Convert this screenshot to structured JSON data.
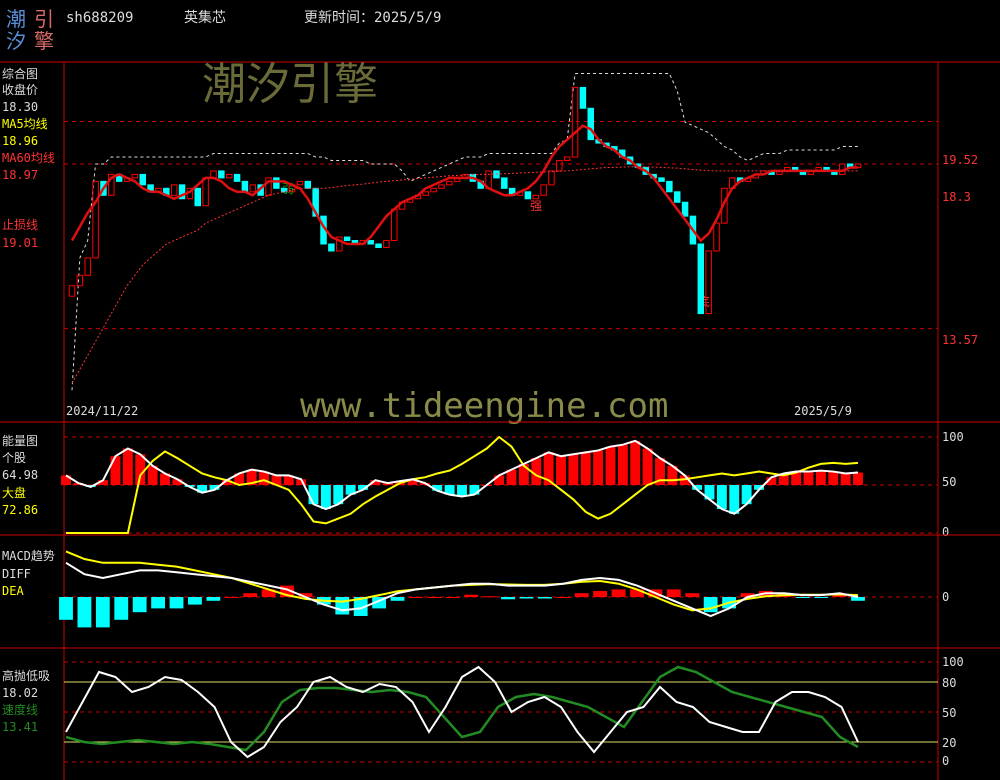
{
  "header": {
    "logo_chars": [
      "潮",
      "引",
      "汐",
      "擎"
    ],
    "code": "sh688209",
    "name": "英集芯",
    "update_label": "更新时间：2025/5/9"
  },
  "watermarks": {
    "brand": "潮汐引擎",
    "url": "www.tideengine.com"
  },
  "colors": {
    "up": "#ff0000",
    "down": "#00ffff",
    "ma5": "#ffffff",
    "ma60": "#ff3333",
    "energy_market": "#ffff00",
    "speed": "#228b22",
    "grid": "#cc0000"
  },
  "panels": {
    "main": {
      "title": "综合图",
      "close_label": "收盘价",
      "close_value": "18.30",
      "ma5_label": "MA5均线",
      "ma5_value": "18.96",
      "ma60_label": "MA60均线",
      "ma60_value": "18.97",
      "stop_label": "止损线",
      "stop_value": "19.01",
      "date_start": "2024/11/22",
      "date_end": "2025/5/9",
      "right_labels": [
        "19.52",
        "18.3",
        "13.57"
      ],
      "markers": [
        "弱",
        "强",
        "底"
      ]
    },
    "energy": {
      "title": "能量图",
      "stock_label": "个股",
      "stock_value": "64.98",
      "market_label": "大盘",
      "market_value": "72.86",
      "axis": [
        "100",
        "50",
        "0"
      ]
    },
    "macd": {
      "title": "MACD趋势",
      "diff_label": "DIFF",
      "dea_label": "DEA",
      "axis": [
        "0"
      ]
    },
    "kdj": {
      "title": "高抛低吸",
      "value": "18.02",
      "speed_label": "速度线",
      "speed_value": "13.41",
      "axis": [
        "100",
        "80",
        "50",
        "20",
        "0"
      ]
    }
  },
  "chart_data": [
    {
      "type": "candlestick",
      "title": "综合图",
      "x_range": [
        "2024/11/22",
        "2025/5/9"
      ],
      "y_labels": [
        19.52,
        18.3,
        13.57
      ],
      "series": [
        {
          "name": "收盘价",
          "values": [
            14.8,
            15.1,
            15.6,
            17.8,
            17.4,
            18.0,
            17.8,
            17.9,
            18.0,
            17.7,
            17.5,
            17.6,
            17.4,
            17.7,
            17.3,
            17.6,
            17.1,
            17.9,
            18.1,
            17.9,
            18.0,
            17.8,
            17.5,
            17.7,
            17.4,
            17.9,
            17.6,
            17.5,
            17.7,
            17.8,
            17.6,
            16.8,
            16.0,
            15.8,
            16.2,
            16.1,
            16.0,
            16.1,
            16.0,
            15.9,
            16.1,
            17.0,
            17.2,
            17.3,
            17.4,
            17.5,
            17.6,
            17.7,
            17.8,
            17.9,
            18.0,
            17.8,
            17.6,
            18.1,
            17.9,
            17.6,
            17.4,
            17.5,
            17.3,
            17.4,
            17.7,
            18.1,
            18.4,
            18.5,
            20.5,
            19.9,
            19.0,
            18.9,
            18.8,
            18.7,
            18.5,
            18.3,
            18.2,
            18.0,
            17.9,
            17.8,
            17.5,
            17.2,
            16.8,
            16.0,
            14.0,
            15.8,
            16.6,
            17.6,
            17.9,
            17.8,
            17.9,
            18.0,
            18.1,
            18.0,
            18.1,
            18.2,
            18.1,
            18.0,
            18.1,
            18.2,
            18.1,
            18.0,
            18.3,
            18.2,
            18.3
          ]
        },
        {
          "name": "MA5均线",
          "values": [
            16.1,
            16.5,
            16.9,
            17.2,
            17.6,
            17.9,
            18.0,
            17.9,
            17.8,
            17.6,
            17.5,
            17.5,
            17.4,
            17.3,
            17.4,
            17.5,
            17.7,
            17.9,
            17.9,
            17.8,
            17.6,
            17.5,
            17.5,
            17.4,
            17.6,
            17.8,
            17.8,
            17.8,
            17.7,
            17.6,
            17.3,
            16.9,
            16.5,
            16.2,
            16.1,
            16.0,
            16.0,
            16.0,
            16.2,
            16.5,
            16.8,
            17.0,
            17.2,
            17.3,
            17.4,
            17.6,
            17.7,
            17.8,
            17.9,
            17.9,
            17.9,
            17.9,
            17.8,
            17.6,
            17.5,
            17.4,
            17.4,
            17.5,
            17.6,
            17.8,
            18.1,
            18.5,
            18.8,
            19.0,
            19.2,
            19.4,
            19.3,
            19.0,
            18.8,
            18.7,
            18.5,
            18.4,
            18.2,
            18.1,
            17.9,
            17.6,
            17.3,
            17.0,
            16.7,
            16.4,
            16.1,
            16.3,
            16.7,
            17.2,
            17.6,
            17.8,
            17.9,
            18.0,
            18.0,
            18.1,
            18.1,
            18.1,
            18.1,
            18.1,
            18.1,
            18.1,
            18.1,
            18.1,
            18.1,
            18.2,
            18.2
          ]
        },
        {
          "name": "MA60均线",
          "values": [
            12.0,
            12.4,
            12.8,
            13.2,
            13.6,
            14.0,
            14.4,
            14.8,
            15.1,
            15.4,
            15.6,
            15.8,
            16.0,
            16.1,
            16.2,
            16.3,
            16.4,
            16.6,
            16.7,
            16.8,
            16.9,
            17.0,
            17.1,
            17.2,
            17.3,
            17.4,
            17.45,
            17.5,
            17.55,
            17.6,
            17.6,
            17.6,
            17.6,
            17.62,
            17.65,
            17.68,
            17.7,
            17.72,
            17.75,
            17.78,
            17.8,
            17.82,
            17.84,
            17.86,
            17.88,
            17.9,
            17.92,
            17.94,
            17.96,
            17.97,
            17.98,
            17.99,
            18.0,
            18.0,
            18.01,
            18.02,
            18.03,
            18.04,
            18.05,
            18.06,
            18.07,
            18.08,
            18.09,
            18.1,
            18.12,
            18.14,
            18.16,
            18.18,
            18.2,
            18.2,
            18.21,
            18.22,
            18.22,
            18.22,
            18.21,
            18.2,
            18.19,
            18.18,
            18.16,
            18.14,
            18.12,
            18.11,
            18.1,
            18.1,
            18.1,
            18.1,
            18.1,
            18.1,
            18.1,
            18.1,
            18.1,
            18.1,
            18.1,
            18.1,
            18.1,
            18.1,
            18.1,
            18.1,
            18.1,
            18.1,
            18.1
          ]
        }
      ]
    },
    {
      "type": "line",
      "title": "能量图",
      "ylim": [
        0,
        100
      ],
      "series": [
        {
          "name": "个股",
          "values": [
            60,
            52,
            48,
            55,
            80,
            88,
            82,
            70,
            62,
            56,
            48,
            42,
            45,
            55,
            62,
            66,
            64,
            60,
            60,
            56,
            30,
            25,
            30,
            40,
            45,
            55,
            52,
            54,
            56,
            52,
            44,
            40,
            38,
            40,
            50,
            60,
            66,
            72,
            78,
            84,
            80,
            82,
            84,
            86,
            90,
            92,
            96,
            88,
            78,
            70,
            60,
            45,
            35,
            25,
            20,
            30,
            45,
            58,
            62,
            64,
            64,
            65,
            64,
            62,
            63
          ]
        },
        {
          "name": "大盘",
          "values": [
            0,
            0,
            0,
            0,
            0,
            0,
            60,
            75,
            85,
            78,
            70,
            62,
            58,
            55,
            50,
            52,
            55,
            50,
            45,
            30,
            12,
            10,
            15,
            20,
            30,
            38,
            45,
            52,
            56,
            58,
            62,
            65,
            72,
            80,
            88,
            100,
            90,
            70,
            60,
            55,
            45,
            35,
            22,
            15,
            20,
            30,
            40,
            50,
            55,
            55,
            56,
            58,
            60,
            62,
            60,
            62,
            64,
            62,
            60,
            63,
            68,
            72,
            73,
            72,
            73
          ]
        }
      ],
      "bars_hint": "red above 50, cyan below 50"
    },
    {
      "type": "line",
      "title": "MACD趋势",
      "series": [
        {
          "name": "DIFF",
          "values": [
            0.9,
            0.6,
            0.5,
            0.6,
            0.7,
            0.7,
            0.65,
            0.6,
            0.55,
            0.5,
            0.4,
            0.3,
            0.2,
            0.0,
            -0.2,
            -0.35,
            -0.3,
            -0.1,
            0.1,
            0.2,
            0.25,
            0.3,
            0.35,
            0.35,
            0.3,
            0.3,
            0.3,
            0.35,
            0.45,
            0.5,
            0.45,
            0.3,
            0.1,
            -0.1,
            -0.3,
            -0.5,
            -0.3,
            0.0,
            0.1,
            0.1,
            0.05,
            0.05,
            0.1,
            0.0
          ]
        },
        {
          "name": "DEA",
          "values": [
            1.2,
            1.0,
            0.9,
            0.9,
            0.9,
            0.85,
            0.8,
            0.7,
            0.6,
            0.5,
            0.35,
            0.2,
            0.05,
            -0.05,
            -0.1,
            -0.12,
            -0.05,
            0.05,
            0.15,
            0.2,
            0.25,
            0.3,
            0.32,
            0.34,
            0.33,
            0.32,
            0.32,
            0.35,
            0.4,
            0.42,
            0.35,
            0.2,
            0.0,
            -0.2,
            -0.35,
            -0.3,
            -0.15,
            -0.05,
            0.02,
            0.05,
            0.06,
            0.06,
            0.07,
            0.05
          ]
        }
      ]
    },
    {
      "type": "line",
      "title": "高抛低吸",
      "ylim": [
        0,
        100
      ],
      "series": [
        {
          "name": "高抛低吸",
          "values": [
            30,
            60,
            90,
            85,
            70,
            75,
            85,
            82,
            70,
            55,
            20,
            5,
            15,
            40,
            55,
            80,
            85,
            75,
            70,
            78,
            75,
            60,
            30,
            55,
            85,
            95,
            80,
            50,
            60,
            65,
            55,
            30,
            10,
            30,
            50,
            55,
            75,
            60,
            55,
            40,
            35,
            30,
            30,
            60,
            70,
            70,
            65,
            55,
            20
          ]
        },
        {
          "name": "速度线",
          "values": [
            25,
            20,
            18,
            20,
            22,
            20,
            18,
            20,
            18,
            15,
            12,
            30,
            60,
            72,
            74,
            74,
            72,
            70,
            72,
            70,
            65,
            45,
            25,
            30,
            55,
            65,
            68,
            65,
            60,
            55,
            45,
            35,
            60,
            85,
            95,
            90,
            80,
            70,
            65,
            60,
            55,
            50,
            45,
            25,
            15
          ]
        }
      ]
    }
  ]
}
